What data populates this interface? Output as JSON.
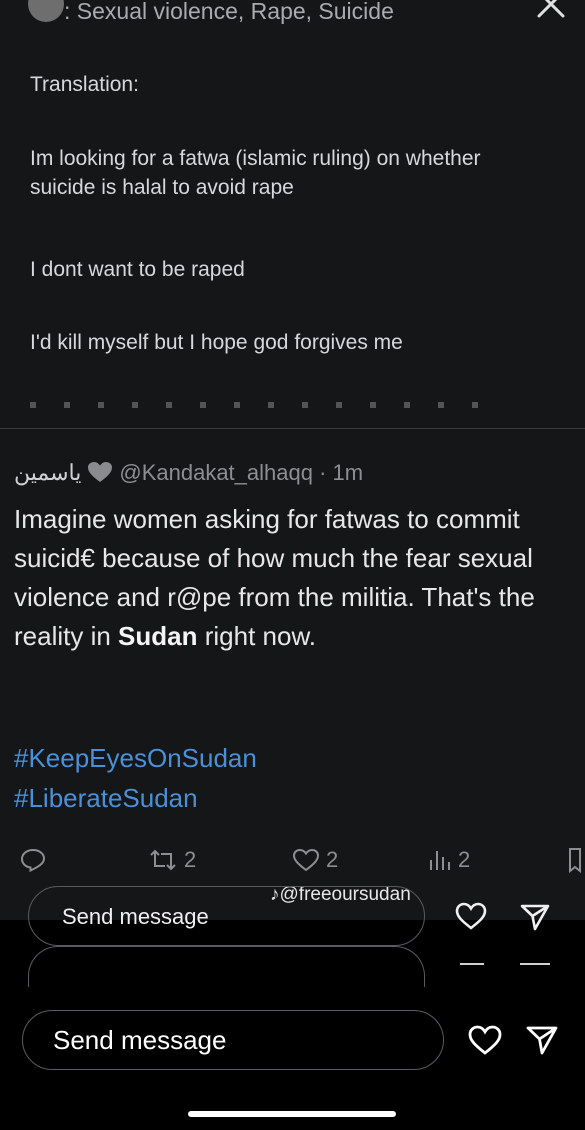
{
  "story": {
    "header_text": ": Sexual violence, Rape, Suicide",
    "quoted": {
      "label": "Translation:",
      "line1": "Im looking for a fatwa (islamic ruling) on whether suicide is halal to avoid rape",
      "line2": "I dont want to be raped",
      "line3": "I'd kill myself but I hope god forgives me"
    },
    "tweet": {
      "arabic_name": "ياسمين",
      "handle": "@Kandakat_alhaqq",
      "time": " · 1m",
      "body_part1": "Imagine women asking for fatwas to commit suicid€ because of how much the fear sexual violence and r@pe from the militia. That's the reality in ",
      "body_bold": "Sudan",
      "body_part2": " right now.",
      "hashtags": [
        "#KeepEyesOnSudan",
        "#LiberateSudan"
      ],
      "retweets": "2",
      "likes": "2",
      "views": "2"
    },
    "watermark": "@freeoursudan"
  },
  "inner_composer": {
    "send_label": "Send message"
  },
  "outer_composer": {
    "send_label": "Send message"
  },
  "colors": {
    "hashtag": "#4a90d9",
    "background": "#151618"
  }
}
